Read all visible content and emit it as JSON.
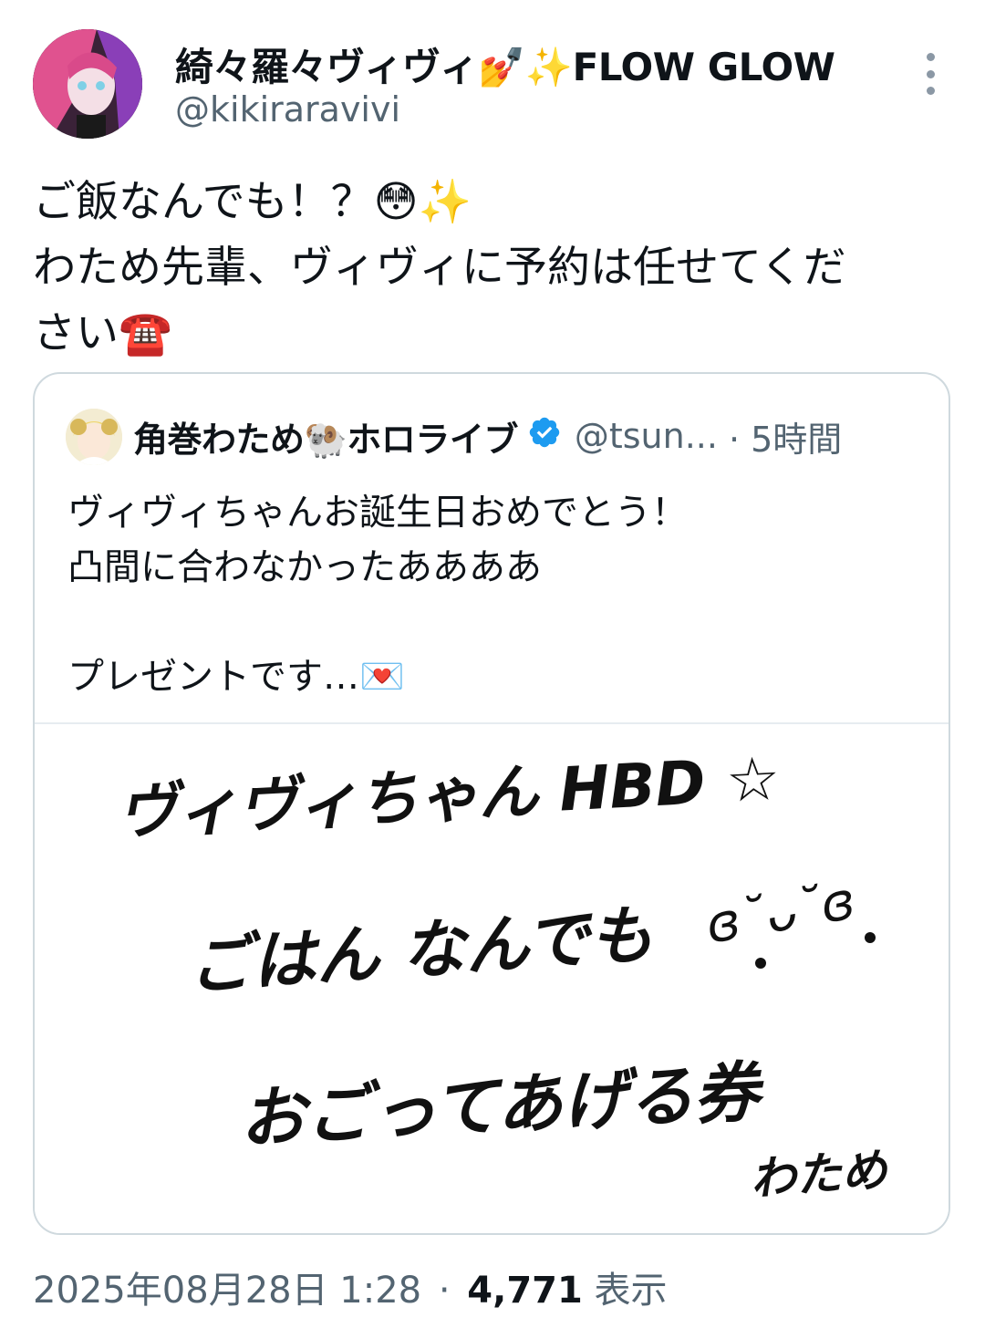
{
  "author": {
    "display_name": "綺々羅々ヴィヴィ💅✨FLOW GLOW",
    "handle": "@kikiraravivi"
  },
  "tweet": {
    "lines": [
      "ご飯なんでも！？😳✨",
      "わため先輩、ヴィヴィに予約は任せてくだ",
      "さい☎️"
    ]
  },
  "quoted_tweet": {
    "display_name": "角巻わため🐏ホロライブ",
    "handle": "@tsun...",
    "time": "· 5時間",
    "lines": [
      "ヴィヴィちゃんお誕生日おめでとう！",
      "凸間に合わなかったああああ",
      "",
      "プレゼントです…💌"
    ],
    "image_text": {
      "line1": "ヴィヴィちゃん HBD ☆",
      "line2": "ごはん なんでも",
      "line3": "おごってあげる券",
      "signature": "わため",
      "face": "ɞ˘ᴗ˘ɞ"
    }
  },
  "footer": {
    "timestamp": "2025年08月28日 1:28",
    "separator": "·",
    "views_count": "4,771",
    "views_label": "表示"
  },
  "colors": {
    "verified": "#1d9bf0",
    "secondary_text": "#536471",
    "border": "#cfd9de"
  }
}
